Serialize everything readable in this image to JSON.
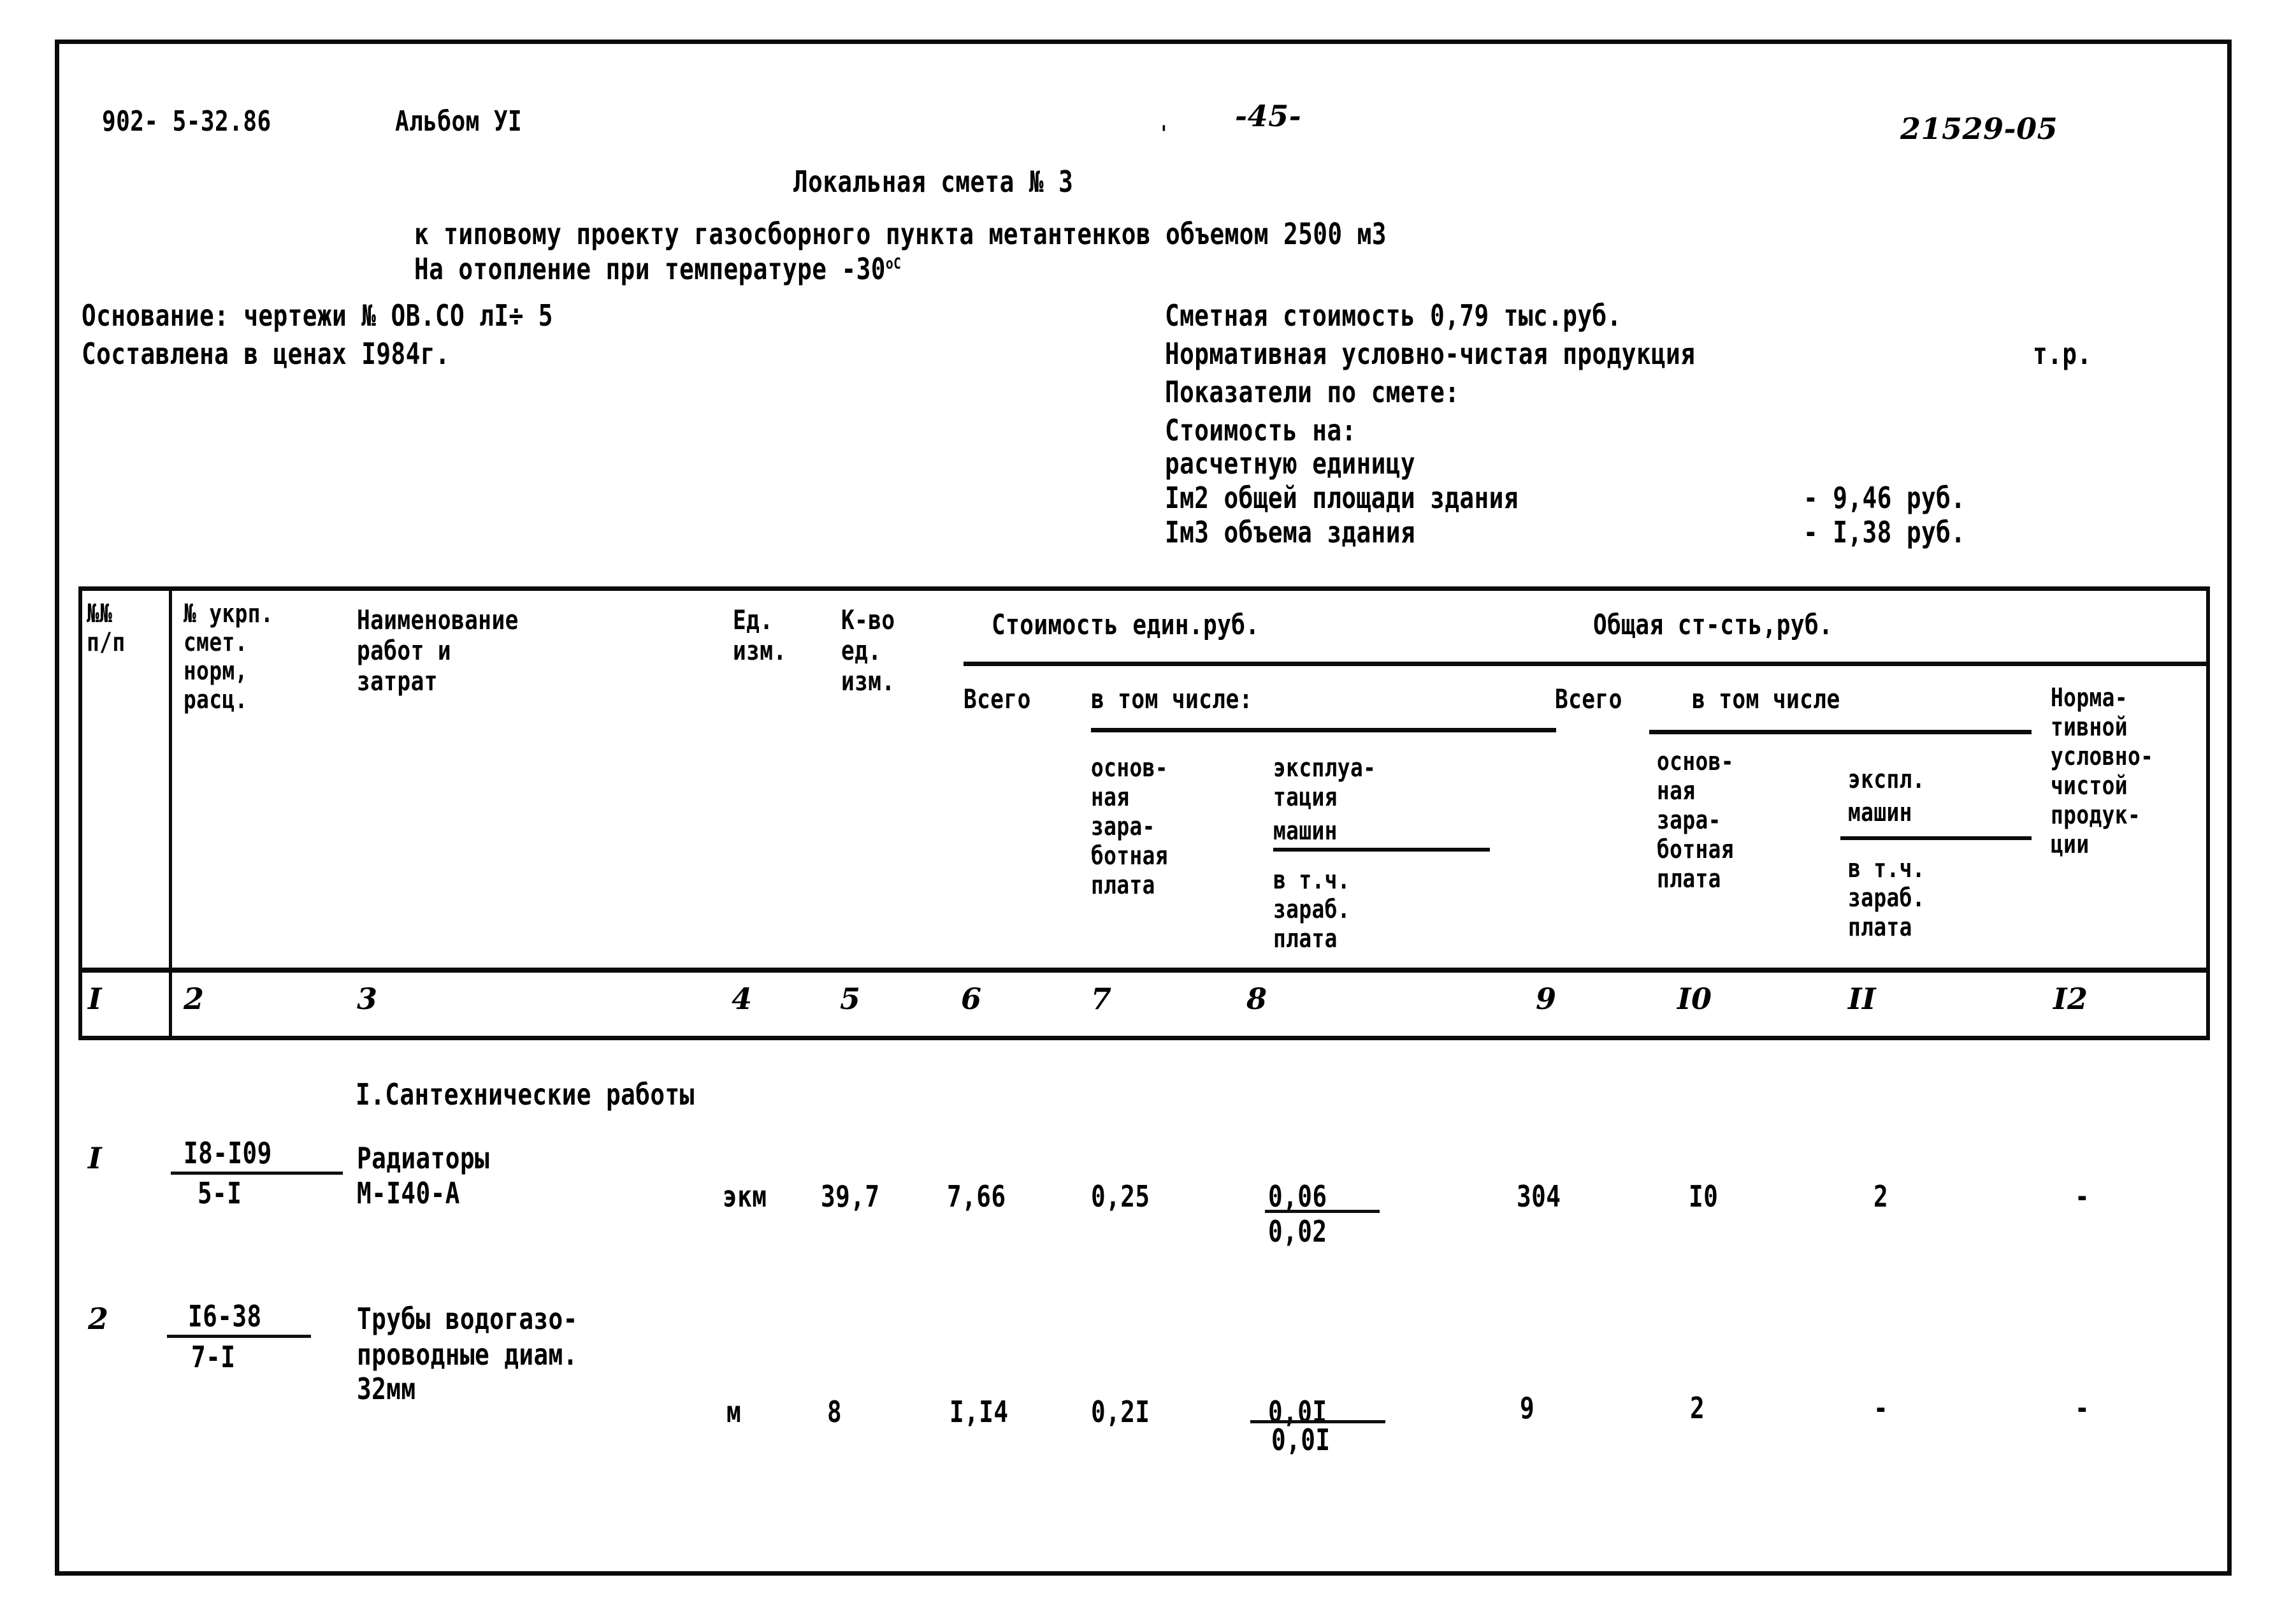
{
  "header": {
    "album_code": "902- 5-32.86",
    "album_label": "Альбом УI",
    "page_number": "-45-",
    "doc_code": "21529-05",
    "title": "Локальная смета № 3",
    "subtitle_1": "к типовому проекту газосборного пункта метантенков объемом 2500 м3",
    "subtitle_2_pre": "На отопление при температуре -30",
    "subtitle_2_sup": "оС"
  },
  "basis": {
    "line_1": "Основание: чертежи № ОВ.СО лI÷ 5",
    "line_2": "Составлена в ценах I984г."
  },
  "summary": {
    "cost_line": "Сметная стоимость 0,79 тыс.руб.",
    "nchp_line": "Нормативная условно-чистая продукция",
    "nchp_unit": "т.р.",
    "indicators_label": "Показатели по смете:",
    "cost_for_label": "Стоимость на:",
    "unit_label": "расчетную единицу",
    "rows": [
      {
        "label": "Iм2 общей площади здания",
        "value": "- 9,46 руб."
      },
      {
        "label": "Iм3 объема здания",
        "value": "- I,38 руб."
      }
    ]
  },
  "table": {
    "headers": {
      "col1": [
        "№№",
        "п/п"
      ],
      "col2": [
        "№ укрп.",
        "смет.",
        "норм,",
        "расц."
      ],
      "col3": [
        "Наименование",
        "работ и",
        "затрат"
      ],
      "col4": [
        "Ед.",
        "изм."
      ],
      "col5": [
        "К-во",
        "ед.",
        "изм."
      ],
      "group_unit_cost": "Стоимость един.руб.",
      "group_unit_total": "Всего",
      "group_unit_incl": "в том числе:",
      "col7": [
        "основ-",
        "ная",
        "зара-",
        "ботная",
        "плата"
      ],
      "col8_top": [
        "эксплуа-",
        "тация",
        "машин"
      ],
      "col8_bottom": [
        "в т.ч.",
        "зараб.",
        "плата"
      ],
      "group_total_cost": "Общая ст-сть,руб.",
      "group_total_total": "Всего",
      "group_total_incl": "в том числе",
      "col10": [
        "основ-",
        "ная",
        "зара-",
        "ботная",
        "плата"
      ],
      "col11_top": [
        "экспл.",
        "машин"
      ],
      "col11_bottom": [
        "в т.ч.",
        "зараб.",
        "плата"
      ],
      "col12": [
        "Норма-",
        "тивной",
        "условно-",
        "чистой",
        "продук-",
        "ции"
      ]
    },
    "column_numbers": [
      "I",
      "2",
      "3",
      "4",
      "5",
      "6",
      "7",
      "8",
      "9",
      "I0",
      "II",
      "I2"
    ],
    "section_title": "I.Сантехнические работы",
    "rows": [
      {
        "no": "I",
        "code_top": "I8-I09",
        "code_bottom": "5-I",
        "name": [
          "Радиаторы",
          "М-I40-А"
        ],
        "unit": "экм",
        "qty": "39,7",
        "unit_total": "7,66",
        "unit_wage": "0,25",
        "unit_mach_top": "0,06",
        "unit_mach_bottom": "0,02",
        "total": "304",
        "total_wage": "I0",
        "total_mach": "2",
        "nchp": "-"
      },
      {
        "no": "2",
        "code_top": "I6-38",
        "code_bottom": "7-I",
        "name": [
          "Трубы водогазо-",
          "проводные диам.",
          "32мм"
        ],
        "unit": "м",
        "qty": "8",
        "unit_total": "I,I4",
        "unit_wage": "0,2I",
        "unit_mach_top": "0,0I",
        "unit_mach_bottom": "0,0I",
        "total": "9",
        "total_wage": "2",
        "total_mach": "-",
        "nchp": "-"
      }
    ]
  }
}
